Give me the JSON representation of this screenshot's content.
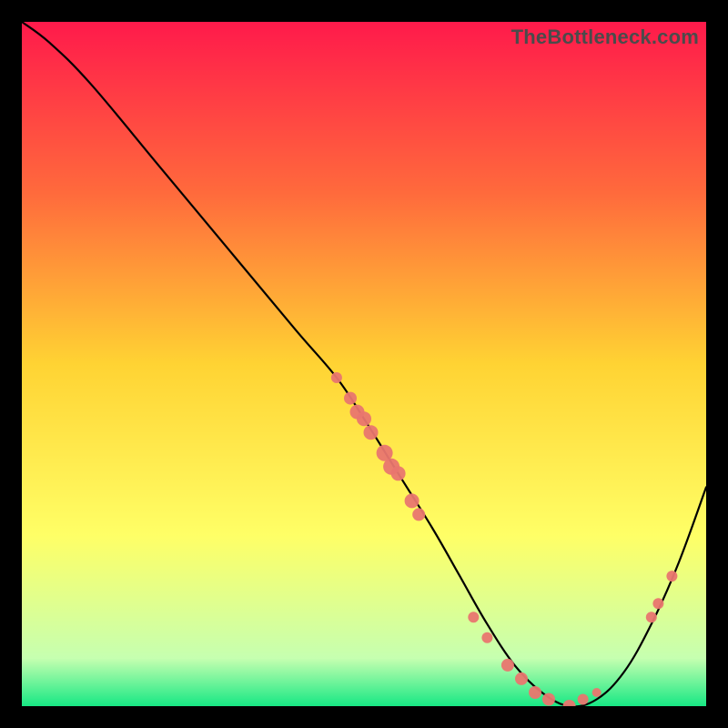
{
  "watermark": "TheBottleneck.com",
  "chart_data": {
    "type": "line",
    "title": "",
    "xlabel": "",
    "ylabel": "",
    "xlim": [
      0,
      100
    ],
    "ylim": [
      0,
      100
    ],
    "gradient_stops": [
      {
        "offset": 0,
        "color": "#ff1a4b"
      },
      {
        "offset": 25,
        "color": "#ff6a3c"
      },
      {
        "offset": 50,
        "color": "#ffd333"
      },
      {
        "offset": 75,
        "color": "#ffff66"
      },
      {
        "offset": 93,
        "color": "#c6ffb0"
      },
      {
        "offset": 100,
        "color": "#17e884"
      }
    ],
    "series": [
      {
        "name": "bottleneck-curve",
        "x": [
          0,
          4,
          10,
          20,
          30,
          40,
          46,
          50,
          55,
          60,
          64,
          68,
          72,
          76,
          80,
          84,
          88,
          92,
          96,
          100
        ],
        "values": [
          100,
          97,
          91,
          79,
          67,
          55,
          48,
          42,
          34,
          26,
          19,
          12,
          6,
          2,
          0,
          1,
          5,
          12,
          21,
          32
        ]
      }
    ],
    "markers": {
      "name": "highlight-points",
      "color": "#e9766f",
      "points": [
        {
          "x": 46,
          "y": 48,
          "r": 6
        },
        {
          "x": 48,
          "y": 45,
          "r": 7
        },
        {
          "x": 49,
          "y": 43,
          "r": 8
        },
        {
          "x": 50,
          "y": 42,
          "r": 8
        },
        {
          "x": 51,
          "y": 40,
          "r": 8
        },
        {
          "x": 53,
          "y": 37,
          "r": 9
        },
        {
          "x": 54,
          "y": 35,
          "r": 9
        },
        {
          "x": 55,
          "y": 34,
          "r": 8
        },
        {
          "x": 57,
          "y": 30,
          "r": 8
        },
        {
          "x": 58,
          "y": 28,
          "r": 7
        },
        {
          "x": 66,
          "y": 13,
          "r": 6
        },
        {
          "x": 68,
          "y": 10,
          "r": 6
        },
        {
          "x": 71,
          "y": 6,
          "r": 7
        },
        {
          "x": 73,
          "y": 4,
          "r": 7
        },
        {
          "x": 75,
          "y": 2,
          "r": 7
        },
        {
          "x": 77,
          "y": 1,
          "r": 7
        },
        {
          "x": 80,
          "y": 0,
          "r": 7
        },
        {
          "x": 82,
          "y": 1,
          "r": 6
        },
        {
          "x": 84,
          "y": 2,
          "r": 5
        },
        {
          "x": 92,
          "y": 13,
          "r": 6
        },
        {
          "x": 93,
          "y": 15,
          "r": 6
        },
        {
          "x": 95,
          "y": 19,
          "r": 6
        }
      ]
    }
  }
}
